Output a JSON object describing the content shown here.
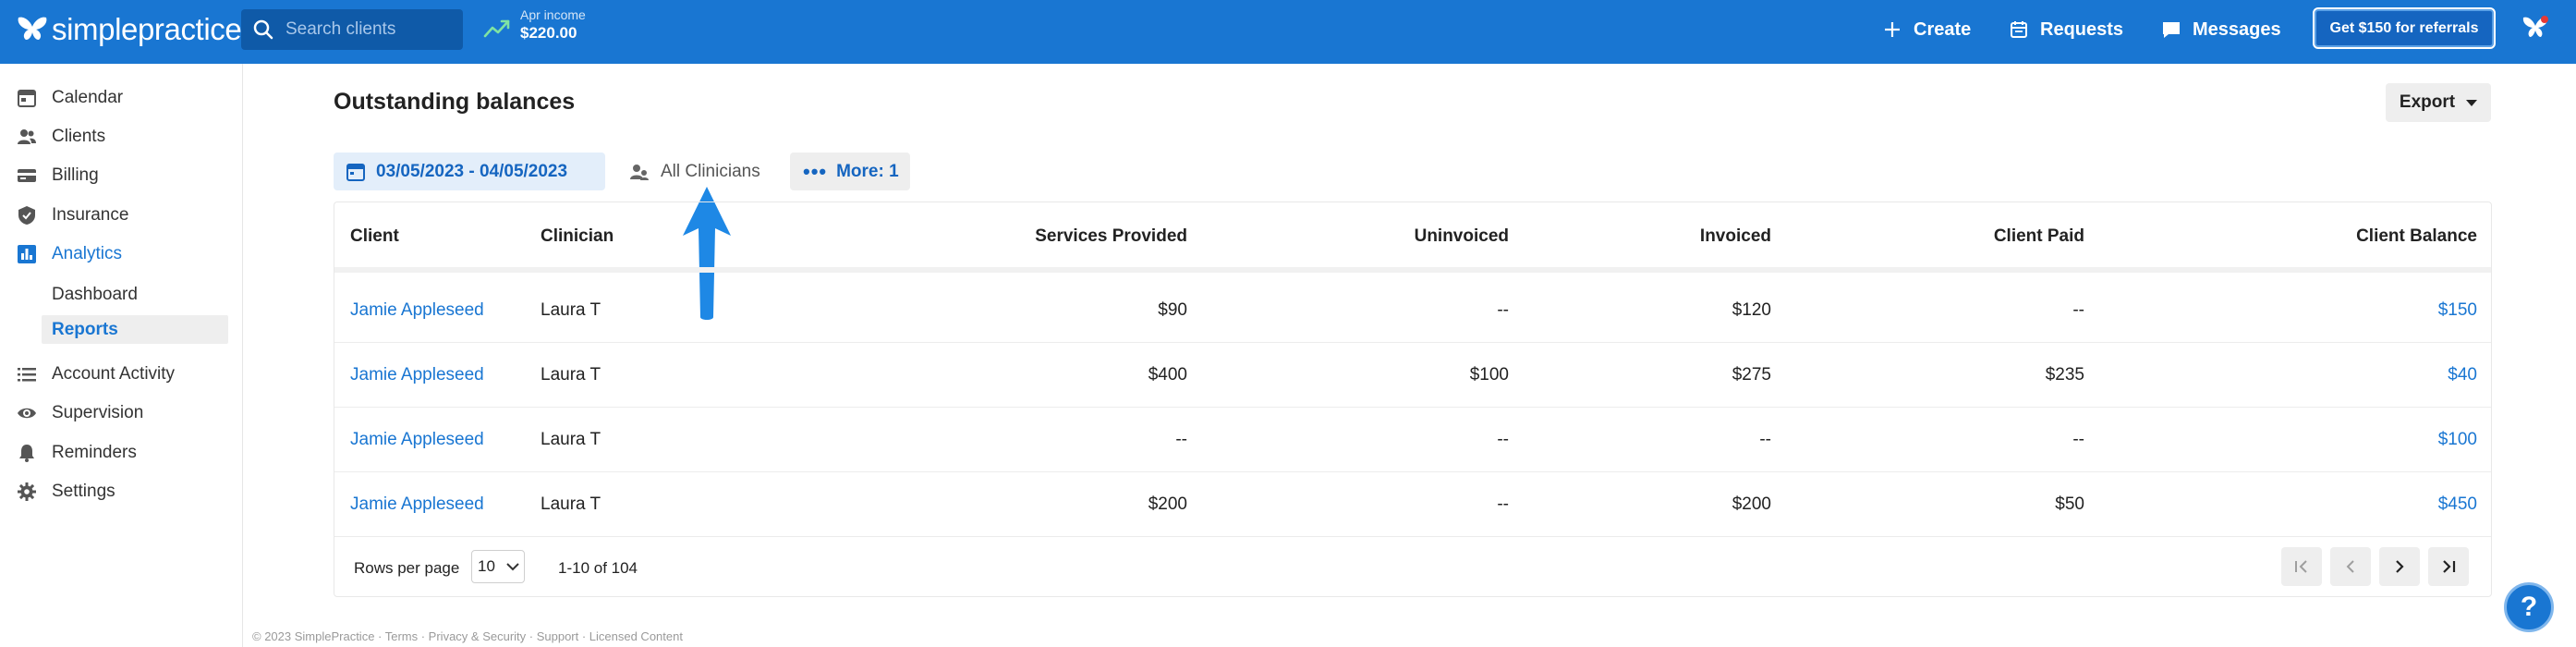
{
  "header": {
    "logo_text": "simplepractice",
    "search_placeholder": "Search clients",
    "income_label": "Apr income",
    "income_value": "$220.00",
    "create_label": "Create",
    "requests_label": "Requests",
    "messages_label": "Messages",
    "referral_label": "Get $150 for referrals"
  },
  "sidebar": {
    "items": [
      {
        "label": "Calendar",
        "icon": "calendar-icon"
      },
      {
        "label": "Clients",
        "icon": "people-icon"
      },
      {
        "label": "Billing",
        "icon": "card-icon"
      },
      {
        "label": "Insurance",
        "icon": "shield-icon"
      },
      {
        "label": "Analytics",
        "icon": "bar-chart-icon"
      },
      {
        "label": "Account Activity",
        "icon": "list-icon"
      },
      {
        "label": "Supervision",
        "icon": "eye-icon"
      },
      {
        "label": "Reminders",
        "icon": "bell-icon"
      },
      {
        "label": "Settings",
        "icon": "gear-icon"
      }
    ],
    "analytics_sub": [
      "Dashboard",
      "Reports"
    ]
  },
  "page": {
    "title": "Outstanding balances",
    "export_label": "Export",
    "filter_date": "03/05/2023 - 04/05/2023",
    "filter_clinicians": "All Clinicians",
    "filter_more": "More: 1"
  },
  "table": {
    "columns": [
      "Client",
      "Clinician",
      "Services Provided",
      "Uninvoiced",
      "Invoiced",
      "Client Paid",
      "Client Balance"
    ],
    "rows": [
      {
        "client": "Jamie Appleseed",
        "clinician": "Laura T",
        "services": "$90",
        "uninvoiced": "--",
        "invoiced": "$120",
        "paid": "--",
        "balance": "$150"
      },
      {
        "client": "Jamie Appleseed",
        "clinician": "Laura T",
        "services": "$400",
        "uninvoiced": "$100",
        "invoiced": "$275",
        "paid": "$235",
        "balance": "$40"
      },
      {
        "client": "Jamie Appleseed",
        "clinician": "Laura T",
        "services": "--",
        "uninvoiced": "--",
        "invoiced": "--",
        "paid": "--",
        "balance": "$100"
      },
      {
        "client": "Jamie Appleseed",
        "clinician": "Laura T",
        "services": "$200",
        "uninvoiced": "--",
        "invoiced": "$200",
        "paid": "$50",
        "balance": "$450"
      }
    ],
    "rows_per_page_label": "Rows per page",
    "rows_per_page_value": "10",
    "range_label": "1-10 of 104"
  },
  "footer": "© 2023 SimplePractice · Terms · Privacy & Security · Support · Licensed Content",
  "help_label": "?",
  "colors": {
    "primary": "#1976d2",
    "link": "#1976d2",
    "filter_bg": "#e3eefa"
  }
}
